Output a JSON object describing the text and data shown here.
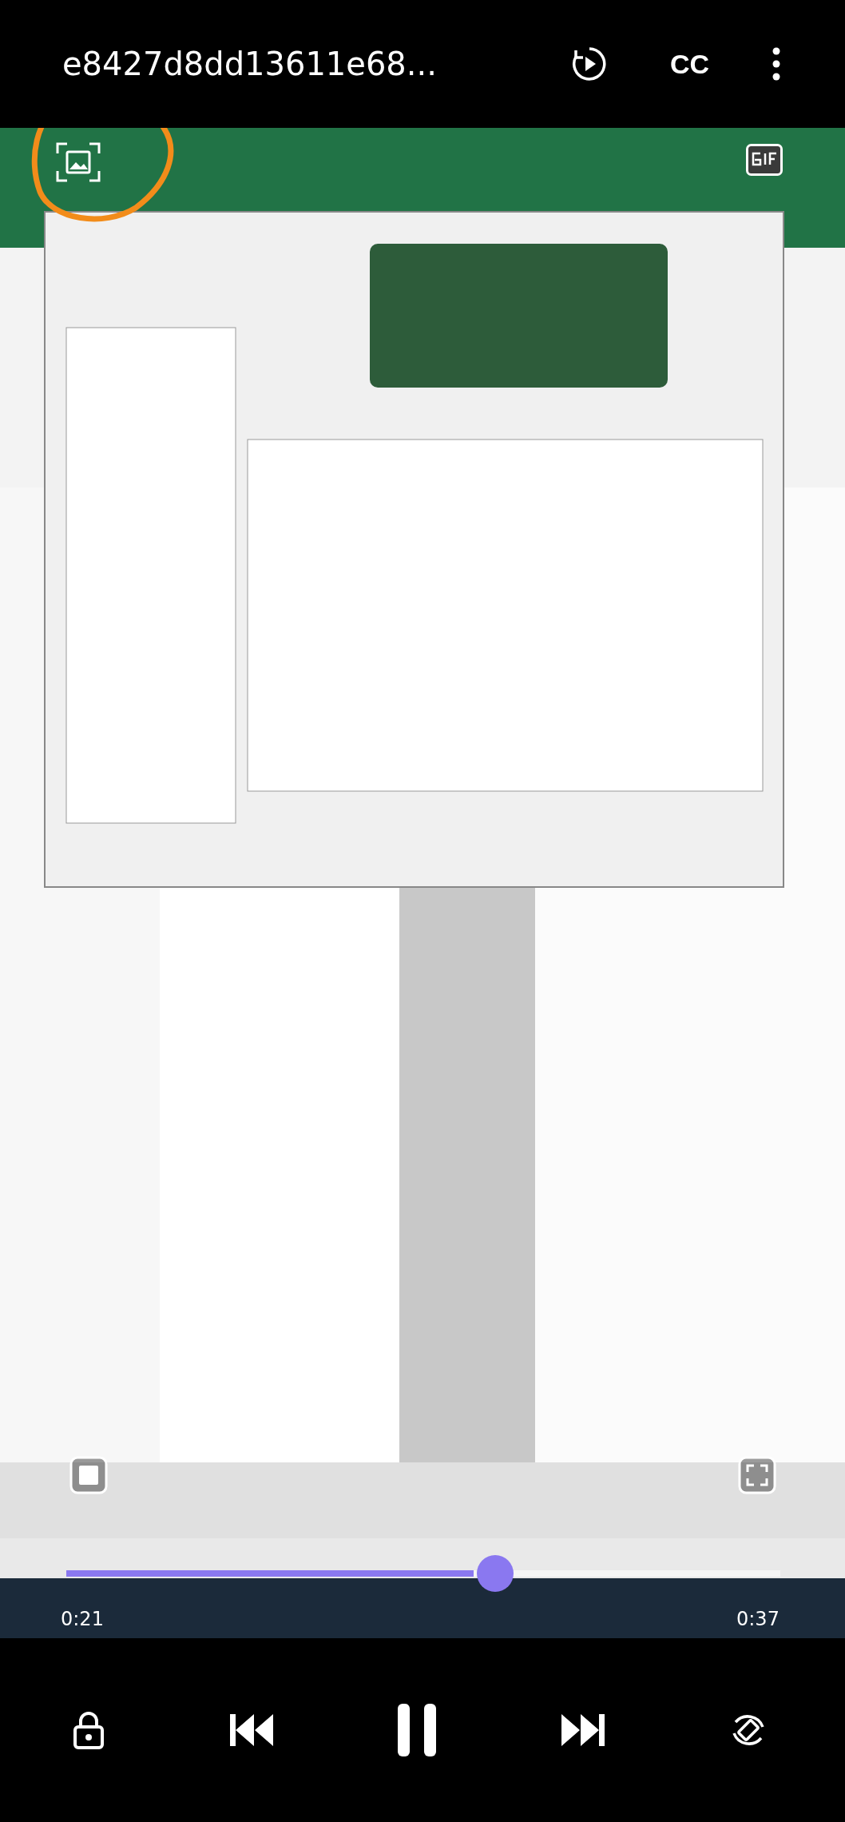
{
  "header": {
    "title": "e8427d8dd13611e68...",
    "captions": "CC"
  },
  "playback": {
    "level": 0.571,
    "elapsed": "0:21",
    "duration": "0:37",
    "playing": true
  }
}
